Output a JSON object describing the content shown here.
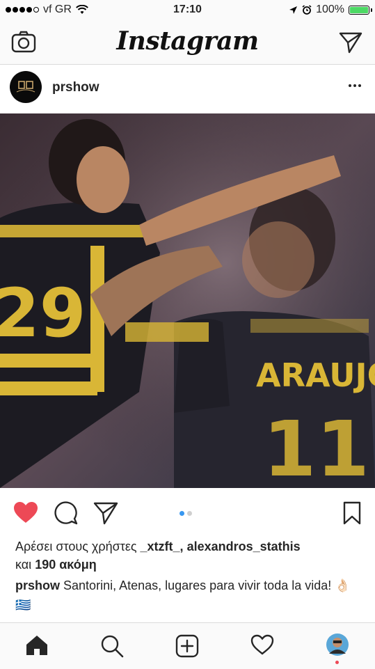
{
  "status_bar": {
    "carrier": "vf GR",
    "time": "17:10",
    "battery": "100%",
    "signal_bars": 4,
    "battery_level": 1.0
  },
  "nav": {
    "logo": "Instagram",
    "left_icon": "camera-icon",
    "right_icon": "direct-message-icon"
  },
  "post": {
    "username": "prshow",
    "more_icon": "more-options-icon",
    "photo": {
      "jersey_name": "ARAUJO",
      "jersey_number_back": "11",
      "jersey_number_front": "29"
    },
    "carousel_total": 2,
    "carousel_active": 1,
    "likes": {
      "prefix": "Αρέσει στους χρήστες",
      "user1": "_xtzft_",
      "separator": ",",
      "user2": "alexandros_stathis",
      "and": "και",
      "count_text": "190 ακόμη"
    },
    "caption": {
      "username": "prshow",
      "text": "Santorini, Atenas, lugares para vivir toda la vida! 👌🏻 🇬🇷"
    }
  },
  "tab_bar": {
    "items": [
      "home-icon",
      "search-icon",
      "new-post-icon",
      "activity-heart-icon",
      "profile-icon"
    ]
  },
  "colors": {
    "like": "#ed4956",
    "carousel_active": "#3897f0",
    "battery": "#4cd964"
  }
}
